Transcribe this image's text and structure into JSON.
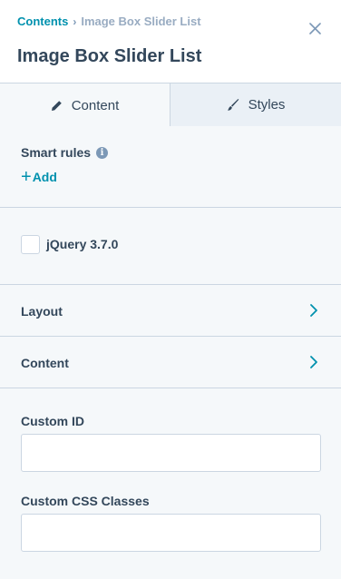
{
  "breadcrumb": {
    "parent": "Contents",
    "separator": "›",
    "current": "Image Box Slider List"
  },
  "header": {
    "title": "Image Box Slider List",
    "close_icon": "close-icon"
  },
  "tabs": [
    {
      "label": "Content",
      "icon": "pencil-icon",
      "active": true
    },
    {
      "label": "Styles",
      "icon": "brush-icon",
      "active": false
    }
  ],
  "smart_rules": {
    "label": "Smart rules",
    "info_icon_glyph": "i",
    "add_label": "Add",
    "add_glyph": "+"
  },
  "jquery": {
    "label": "jQuery 3.7.0",
    "checked": false
  },
  "accordions": [
    {
      "label": "Layout"
    },
    {
      "label": "Content"
    }
  ],
  "fields": {
    "custom_id": {
      "label": "Custom ID",
      "value": ""
    },
    "custom_css": {
      "label": "Custom CSS Classes",
      "value": ""
    }
  },
  "colors": {
    "accent": "#0091ae",
    "text": "#33475b",
    "panel_bg": "#f5f8fa",
    "border": "#cbd6e2"
  }
}
